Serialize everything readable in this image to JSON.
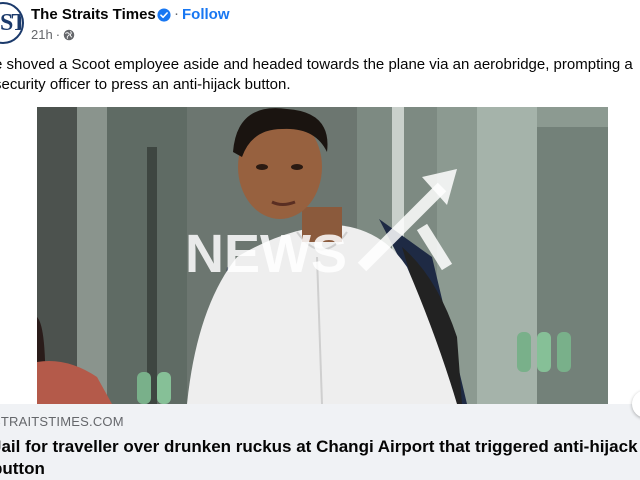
{
  "post": {
    "page_name": "The Straits Times",
    "avatar_text": "ST",
    "follow_label": "Follow",
    "separator": "·",
    "time": "21h",
    "time_separator": "·",
    "caption": "e shoved a Scoot employee aside and headed towards the plane via an aerobridge, prompting a security officer to press an anti-hijack button."
  },
  "image": {
    "watermark": "NEWS"
  },
  "link": {
    "domain": "STRAITSTIMES.COM",
    "headline": "Jail for traveller over drunken ruckus at Changi Airport that triggered anti-hijack button"
  },
  "colors": {
    "follow": "#1877f2",
    "verified": "#1877f2",
    "secondary_text": "#65676b",
    "card_bg": "#f0f2f5",
    "brand_navy": "#1b3a6b"
  },
  "icons": {
    "verified": "verified-badge-icon",
    "privacy": "globe-icon"
  }
}
